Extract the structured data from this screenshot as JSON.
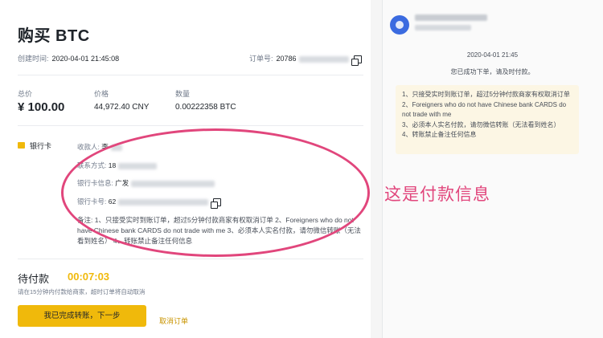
{
  "order": {
    "title": "购买 BTC",
    "created_label": "创建时间:",
    "created_value": "2020-04-01 21:45:08",
    "order_no_label": "订单号:",
    "order_no_value": "20786"
  },
  "summary": {
    "total_label": "总价",
    "total_value": "¥ 100.00",
    "price_label": "价格",
    "price_value": "44,972.40 CNY",
    "qty_label": "数量",
    "qty_value": "0.00222358 BTC"
  },
  "payment": {
    "method_label": "银行卡",
    "payee_label": "收款人:",
    "payee_value": "李",
    "contact_label": "联系方式:",
    "contact_value": "18",
    "bank_info_label": "银行卡信息:",
    "bank_info_value": "广发",
    "card_no_label": "银行卡号:",
    "card_no_value": "62",
    "note_label": "备注:",
    "note_value": "1、只接受实时到账订单，超过5分钟付款商家有权取消订单 2、Foreigners who do not have Chinese bank CARDS do not trade with me 3、必须本人实名付款，请勿微信转账（无法看到姓名） 4、转账禁止备注任何信息"
  },
  "status": {
    "pending_label": "待付款",
    "timer": "00:07:03",
    "hint": "请在15分钟内付款给商家，超时订单将自动取消",
    "confirm_button": "我已完成转账，下一步",
    "cancel_link": "取消订单"
  },
  "annotation": "这是付款信息",
  "chat": {
    "time": "2020-04-01 21:45",
    "system_msg": "您已成功下单，请及时付款。",
    "message_lines": [
      "1、只接受实时到账订单，超过5分钟付款商家有权取消订单",
      "2、Foreigners who do not have Chinese bank CARDS do not trade with me",
      "3、必须本人实名付款，请勿微信转账（无法看到姓名）",
      "4、转账禁止备注任何信息"
    ]
  },
  "colors": {
    "accent": "#f0b90b",
    "annotation": "#e1467c"
  }
}
